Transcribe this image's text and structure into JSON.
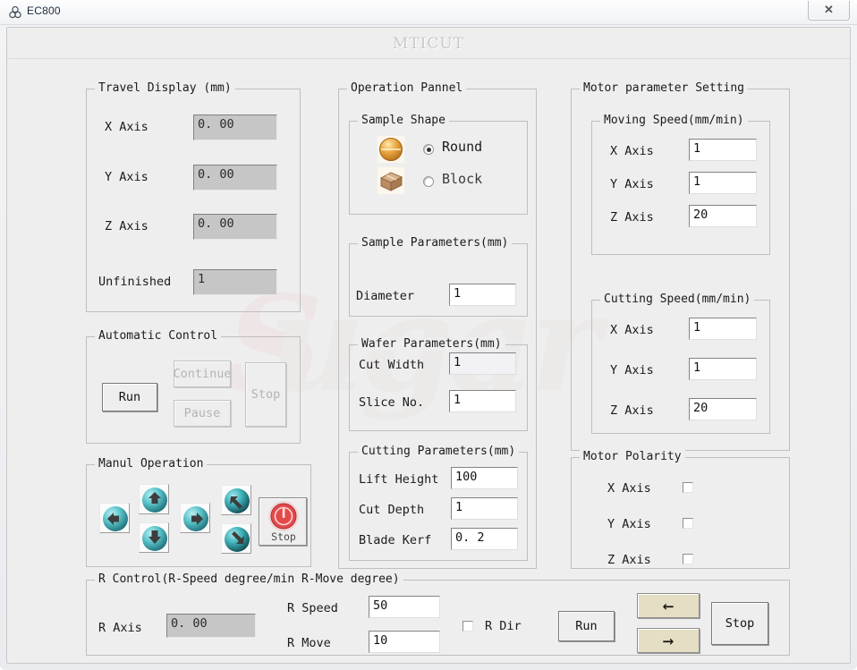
{
  "window": {
    "titlebar_text": "EC800",
    "titlebar_icon": "molecule-icon",
    "close_label": "✕",
    "app_title": "MTICUT",
    "watermark_text": "Sugar"
  },
  "travel_display": {
    "group_title": "Travel Display (mm)",
    "rows": [
      {
        "label": "X Axis",
        "value": "0. 00"
      },
      {
        "label": "Y Axis",
        "value": "0. 00"
      },
      {
        "label": "Z Axis",
        "value": "0. 00"
      }
    ],
    "unfinished_label": "Unfinished",
    "unfinished_value": "1"
  },
  "automatic_control": {
    "group_title": "Automatic Control",
    "run_label": "Run",
    "continue_label": "Continue",
    "pause_label": "Pause",
    "stop_label": "Stop",
    "run_enabled": true,
    "continue_enabled": false,
    "pause_enabled": false,
    "stop_enabled": false
  },
  "manual_operation": {
    "group_title": "Manul Operation",
    "buttons": [
      {
        "name": "move-left-button",
        "icon": "arrow-left-sphere-icon"
      },
      {
        "name": "move-up-button",
        "icon": "arrow-up-sphere-icon"
      },
      {
        "name": "move-down-button",
        "icon": "arrow-down-sphere-icon"
      },
      {
        "name": "move-right-button",
        "icon": "arrow-right-sphere-icon"
      },
      {
        "name": "z-up-button",
        "icon": "arrow-diag-up-sphere-icon"
      },
      {
        "name": "z-down-button",
        "icon": "arrow-diag-down-sphere-icon"
      }
    ],
    "stop_label": "Stop"
  },
  "operation_pannel": {
    "group_title": "Operation Pannel",
    "sample_shape": {
      "group_title": "Sample Shape",
      "options": [
        {
          "label": "Round",
          "selected": true,
          "icon": "sphere-sample-icon"
        },
        {
          "label": "Block",
          "selected": false,
          "icon": "box-sample-icon"
        }
      ]
    },
    "sample_parameters": {
      "group_title": "Sample Parameters(mm)",
      "diameter_label": "Diameter",
      "diameter_value": "1"
    },
    "wafer_parameters": {
      "group_title": "Wafer Parameters(mm)",
      "cut_width_label": "Cut Width",
      "cut_width_value": "1",
      "slice_no_label": "Slice No.",
      "slice_no_value": "1"
    },
    "cutting_parameters": {
      "group_title": "Cutting Parameters(mm)",
      "lift_height_label": "Lift Height",
      "lift_height_value": "100",
      "cut_depth_label": "Cut Depth",
      "cut_depth_value": "1",
      "blade_kerf_label": "Blade Kerf",
      "blade_kerf_value": "0. 2"
    }
  },
  "motor_parameter_setting": {
    "group_title": "Motor parameter Setting",
    "moving_speed": {
      "group_title": "Moving Speed(mm/min)",
      "rows": [
        {
          "label": "X Axis",
          "value": "1"
        },
        {
          "label": "Y Axis",
          "value": "1"
        },
        {
          "label": "Z Axis",
          "value": "20"
        }
      ]
    },
    "cutting_speed": {
      "group_title": "Cutting Speed(mm/min)",
      "rows": [
        {
          "label": "X Axis",
          "value": "1"
        },
        {
          "label": "Y Axis",
          "value": "1"
        },
        {
          "label": "Z Axis",
          "value": "20"
        }
      ]
    }
  },
  "motor_polarity": {
    "group_title": "Motor Polarity",
    "rows": [
      {
        "label": "X Axis",
        "checked": false
      },
      {
        "label": "Y Axis",
        "checked": false
      },
      {
        "label": "Z Axis",
        "checked": false
      }
    ]
  },
  "r_control": {
    "group_title": "R Control(R-Speed degree/min   R-Move degree)",
    "r_axis_label": "R Axis",
    "r_axis_value": "0. 00",
    "r_speed_label": "R Speed",
    "r_speed_value": "50",
    "r_move_label": "R Move",
    "r_move_value": "10",
    "r_dir_label": "R Dir",
    "r_dir_checked": false,
    "run_label": "Run",
    "stop_label": "Stop",
    "left_arrow": "←",
    "right_arrow": "→"
  },
  "colors": {
    "face": "#eeeeee",
    "readonly_field": "#c6c6c6",
    "tan_button": "#e4dec4",
    "sphere_teal": "#56c3c8",
    "sample_round": "#e8a33d",
    "sample_block": "#b5825a",
    "stop_red": "#e24a4a"
  }
}
